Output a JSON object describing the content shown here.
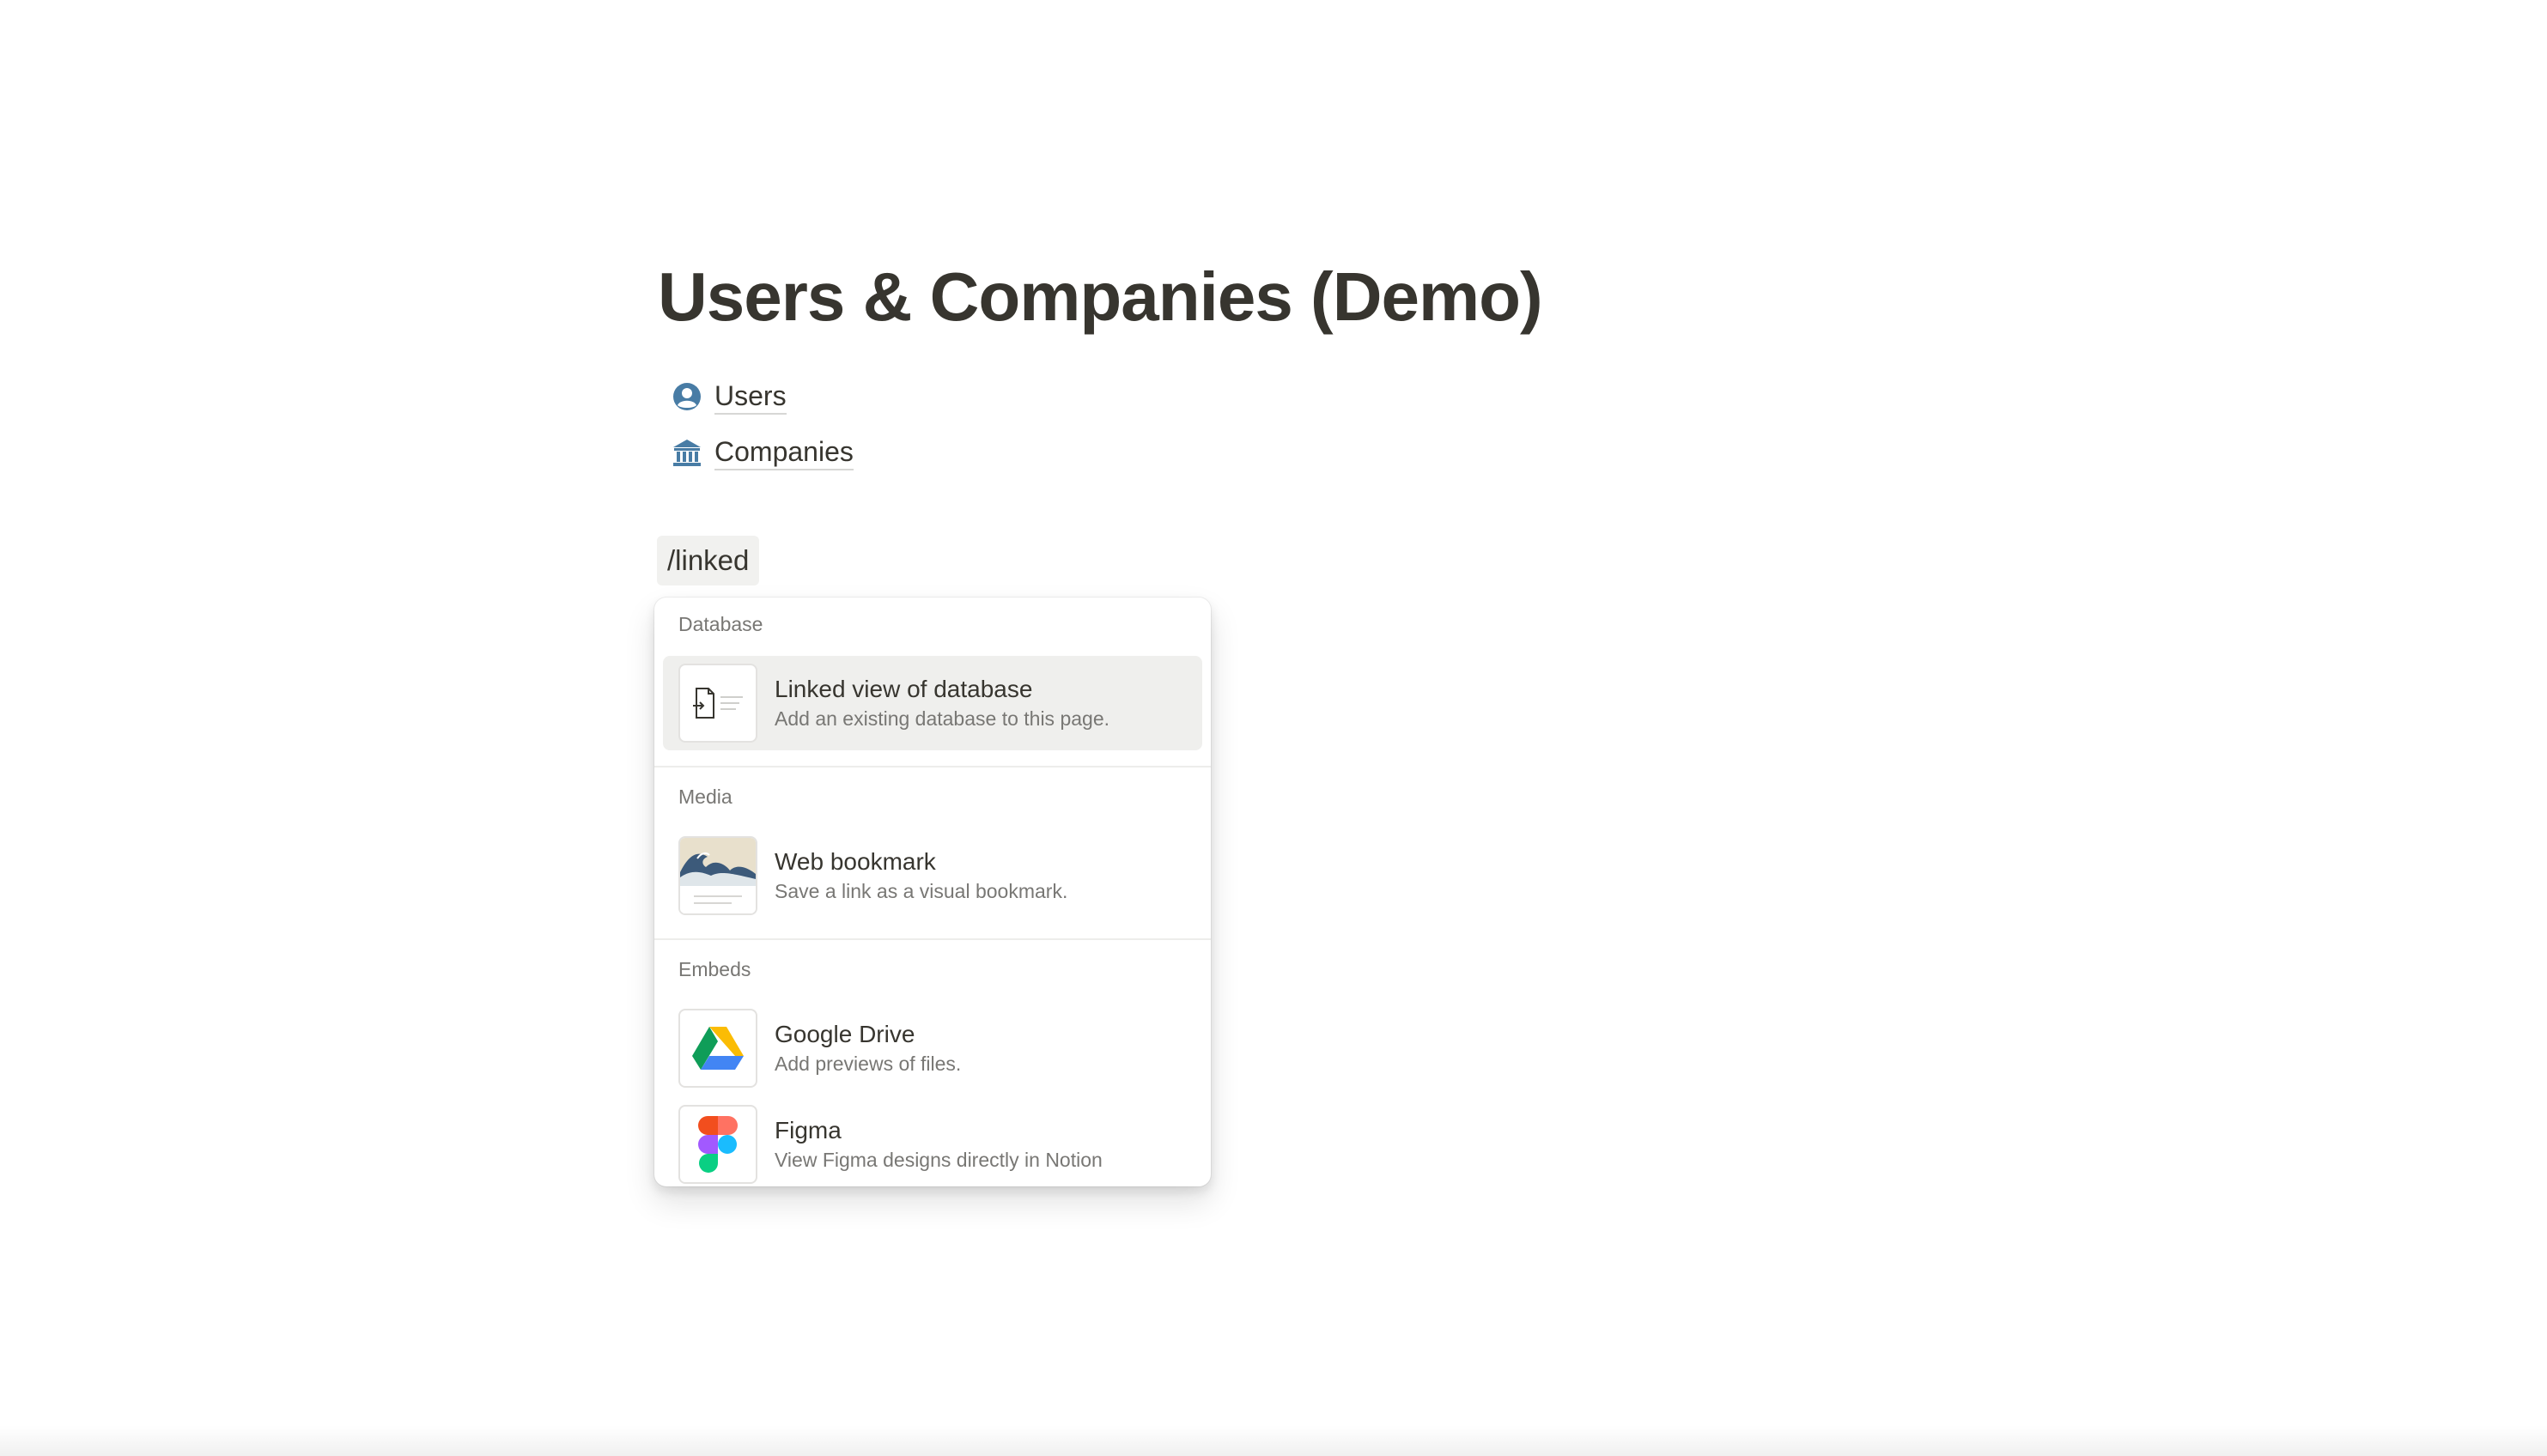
{
  "page": {
    "title": "Users & Companies (Demo)",
    "links": [
      {
        "label": "Users",
        "icon": "user-circle-icon"
      },
      {
        "label": "Companies",
        "icon": "bank-building-icon"
      }
    ],
    "slash_command": "/linked"
  },
  "menu": {
    "sections": [
      {
        "header": "Database",
        "items": [
          {
            "title": "Linked view of database",
            "description": "Add an existing database to this page.",
            "icon": "linked-database-icon",
            "selected": true
          }
        ]
      },
      {
        "header": "Media",
        "items": [
          {
            "title": "Web bookmark",
            "description": "Save a link as a visual bookmark.",
            "icon": "web-bookmark-icon"
          }
        ]
      },
      {
        "header": "Embeds",
        "items": [
          {
            "title": "Google Drive",
            "description": "Add previews of files.",
            "icon": "google-drive-icon"
          },
          {
            "title": "Figma",
            "description": "View Figma designs directly in Notion",
            "icon": "figma-icon"
          }
        ]
      }
    ]
  },
  "colors": {
    "text": "#37352f",
    "muted": "#787774",
    "icon_blue": "#487ca5",
    "highlight": "#efefed"
  }
}
